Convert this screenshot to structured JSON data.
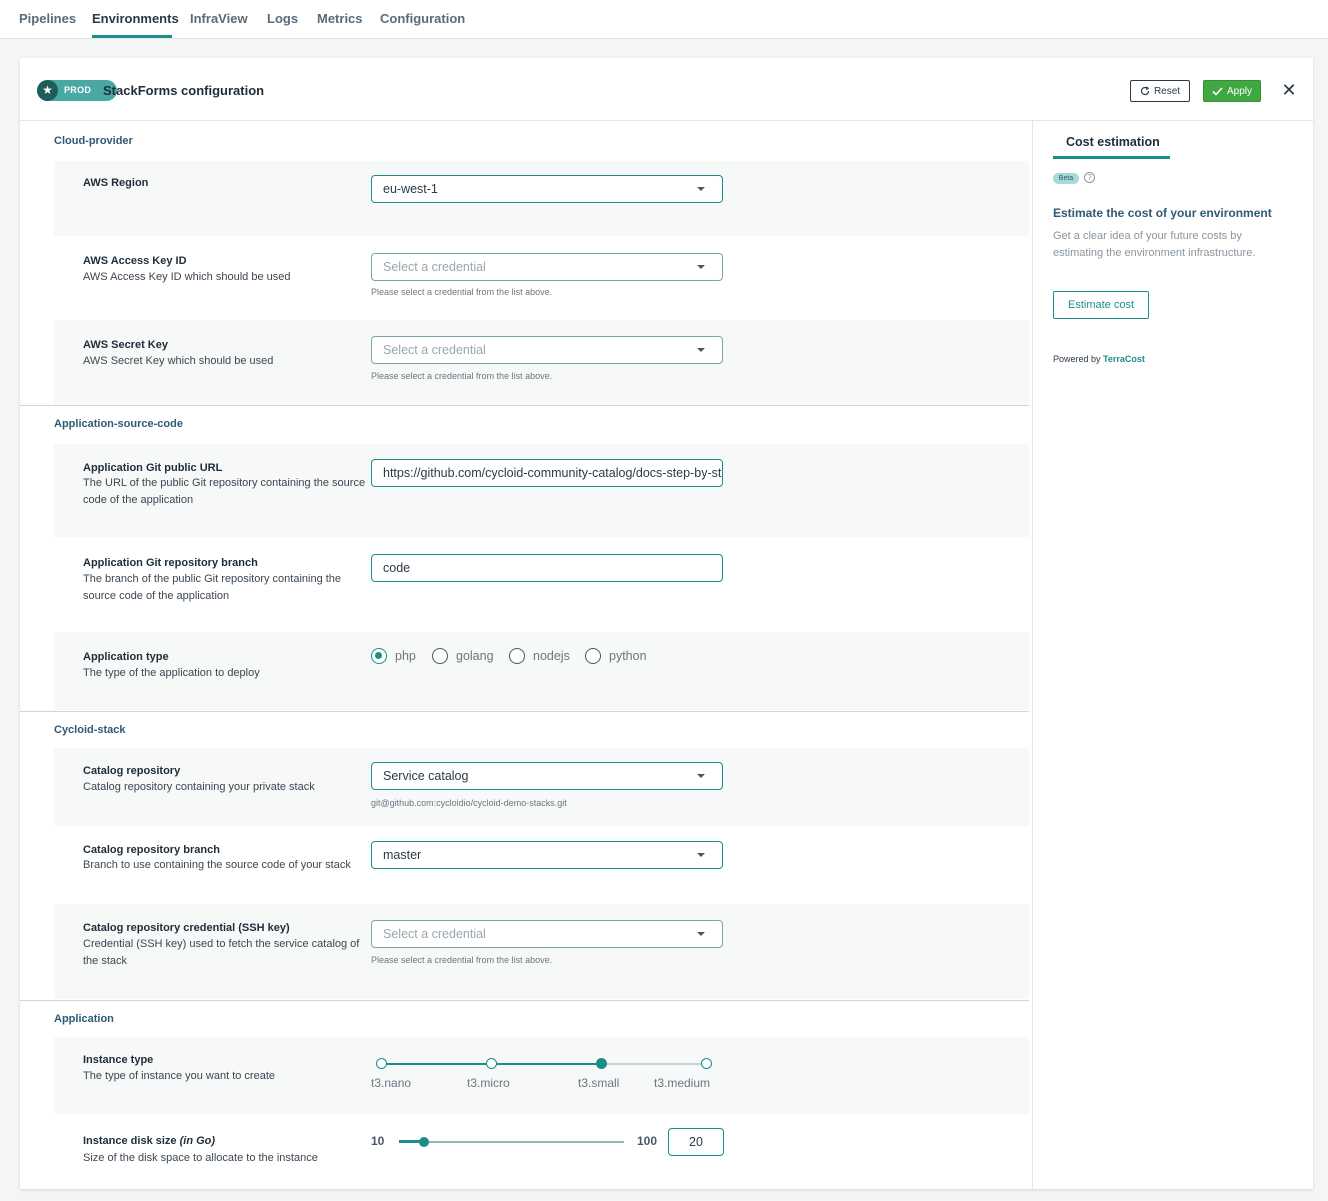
{
  "nav": {
    "tabs": [
      {
        "label": "Pipelines"
      },
      {
        "label": "Environments"
      },
      {
        "label": "InfraView"
      },
      {
        "label": "Logs"
      },
      {
        "label": "Metrics"
      },
      {
        "label": "Configuration"
      }
    ],
    "active": "Environments"
  },
  "header": {
    "badge": "PROD",
    "title": "StackForms configuration",
    "reset_label": "Reset",
    "apply_label": "Apply"
  },
  "sections": {
    "cloud": {
      "title": "Cloud-provider",
      "aws_region": {
        "label": "AWS Region",
        "value": "eu-west-1"
      },
      "access_key": {
        "label": "AWS Access Key ID",
        "desc": "AWS Access Key ID which should be used",
        "placeholder": "Select a credential",
        "hint": "Please select a credential from the list above."
      },
      "secret_key": {
        "label": "AWS Secret Key",
        "desc": "AWS Secret Key which should be used",
        "placeholder": "Select a credential",
        "hint": "Please select a credential from the list above."
      }
    },
    "app_source": {
      "title": "Application-source-code",
      "git_url": {
        "label": "Application Git public URL",
        "desc": "The URL of the public Git repository containing the source code of the application",
        "value": "https://github.com/cycloid-community-catalog/docs-step-by-step"
      },
      "git_branch": {
        "label": "Application Git repository branch",
        "desc": "The branch of the public Git repository containing the source code of the application",
        "value": "code"
      },
      "app_type": {
        "label": "Application type",
        "desc": "The type of the application to deploy",
        "options": [
          "php",
          "golang",
          "nodejs",
          "python"
        ],
        "selected": "php"
      }
    },
    "stack": {
      "title": "Cycloid-stack",
      "catalog_repo": {
        "label": "Catalog repository",
        "desc": "Catalog repository containing your private stack",
        "value": "Service catalog",
        "hint": "git@github.com:cycloidio/cycloid-demo-stacks.git"
      },
      "catalog_branch": {
        "label": "Catalog repository branch",
        "desc": "Branch to use containing the source code of your stack",
        "value": "master"
      },
      "catalog_cred": {
        "label": "Catalog repository credential (SSH key)",
        "desc": "Credential (SSH key) used to fetch the service catalog of the stack",
        "placeholder": "Select a credential",
        "hint": "Please select a credential from the list above."
      }
    },
    "application": {
      "title": "Application",
      "instance_type": {
        "label": "Instance type",
        "desc": "The type of instance you want to create",
        "options": [
          "t3.nano",
          "t3.micro",
          "t3.small",
          "t3.medium"
        ],
        "selected": "t3.small"
      },
      "disk_size": {
        "label_main": "Instance disk size ",
        "label_unit": "(in Go)",
        "desc": "Size of the disk space to allocate to the instance",
        "min": "10",
        "max": "100",
        "value": "20",
        "min_num": 10,
        "max_num": 100,
        "value_num": 20
      }
    }
  },
  "side": {
    "tab": "Cost estimation",
    "beta": "Beta",
    "help": "?",
    "heading": "Estimate the cost of your environment",
    "text": "Get a clear idea of your future costs by estimating the environment infrastructure.",
    "button": "Estimate cost",
    "powered_prefix": "Powered by ",
    "powered_brand": "TerraCost"
  },
  "colors": {
    "accent": "#1b8e8a",
    "apply": "#3fa843",
    "section": "#2f5a75"
  },
  "icons": {
    "badge": "star-icon",
    "reset": "refresh-icon",
    "apply": "check-icon",
    "close": "close-icon"
  }
}
